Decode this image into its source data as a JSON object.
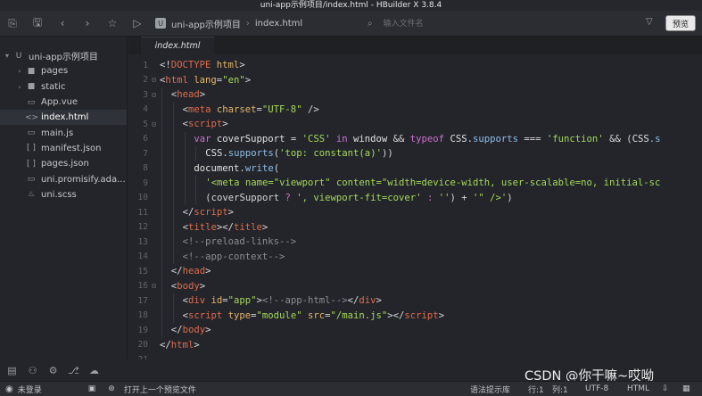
{
  "window": {
    "title": "uni-app示例项目/index.html - HBuilder X 3.8.4"
  },
  "toolbar": {
    "breadcrumb": [
      "uni-app示例项目",
      "index.html"
    ],
    "search_placeholder": "输入文件名",
    "preview_label": "预览"
  },
  "sidebar": {
    "items": [
      {
        "label": "uni-app示例项目",
        "icon": "project-icon",
        "arrow": "▾"
      },
      {
        "label": "pages",
        "icon": "folder-icon",
        "arrow": "›"
      },
      {
        "label": "static",
        "icon": "folder-icon",
        "arrow": "›"
      },
      {
        "label": "App.vue",
        "icon": "vue-file-icon",
        "arrow": ""
      },
      {
        "label": "index.html",
        "icon": "html-file-icon",
        "arrow": ""
      },
      {
        "label": "main.js",
        "icon": "js-file-icon",
        "arrow": ""
      },
      {
        "label": "manifest.json",
        "icon": "json-file-icon",
        "arrow": ""
      },
      {
        "label": "pages.json",
        "icon": "json-file-icon",
        "arrow": ""
      },
      {
        "label": "uni.promisify.ada...",
        "icon": "js-file-icon",
        "arrow": ""
      },
      {
        "label": "uni.scss",
        "icon": "scss-file-icon",
        "arrow": ""
      }
    ],
    "active_index": 4
  },
  "editor": {
    "tab_label": "index.html",
    "lines": [
      {
        "n": "1",
        "fold": "",
        "indent": 0,
        "tokens": [
          [
            "<!",
            "t"
          ],
          [
            "DOCTYPE",
            "r"
          ],
          [
            " html",
            "a"
          ],
          [
            ">",
            "t"
          ]
        ]
      },
      {
        "n": "2",
        "fold": "⊟",
        "indent": 0,
        "tokens": [
          [
            "<",
            "t"
          ],
          [
            "html",
            "r"
          ],
          [
            " lang",
            "a"
          ],
          [
            "=",
            "t"
          ],
          [
            "\"en\"",
            "s"
          ],
          [
            ">",
            "t"
          ]
        ]
      },
      {
        "n": "3",
        "fold": "⊟",
        "indent": 1,
        "tokens": [
          [
            "<",
            "t"
          ],
          [
            "head",
            "r"
          ],
          [
            ">",
            "t"
          ]
        ]
      },
      {
        "n": "4",
        "fold": "",
        "indent": 2,
        "tokens": [
          [
            "<",
            "t"
          ],
          [
            "meta",
            "r"
          ],
          [
            " charset",
            "a"
          ],
          [
            "=",
            "t"
          ],
          [
            "\"UTF-8\"",
            "s"
          ],
          [
            " />",
            "t"
          ]
        ]
      },
      {
        "n": "5",
        "fold": "⊟",
        "indent": 2,
        "tokens": [
          [
            "<",
            "t"
          ],
          [
            "script",
            "r"
          ],
          [
            ">",
            "t"
          ]
        ]
      },
      {
        "n": "6",
        "fold": "",
        "indent": 3,
        "tokens": [
          [
            "var ",
            "k"
          ],
          [
            "coverSupport ",
            "p"
          ],
          [
            "= ",
            "t"
          ],
          [
            "'CSS'",
            "s"
          ],
          [
            " in ",
            "k"
          ],
          [
            "window ",
            "p"
          ],
          [
            "&& ",
            "t"
          ],
          [
            "typeof ",
            "k"
          ],
          [
            "CSS",
            "p"
          ],
          [
            ".",
            "t"
          ],
          [
            "supports ",
            "f"
          ],
          [
            "=== ",
            "t"
          ],
          [
            "'function'",
            "s"
          ],
          [
            " && (",
            "t"
          ],
          [
            "CSS",
            "p"
          ],
          [
            ".s",
            "f"
          ]
        ]
      },
      {
        "n": "7",
        "fold": "",
        "indent": 4,
        "tokens": [
          [
            "CSS",
            "p"
          ],
          [
            ".",
            "t"
          ],
          [
            "supports",
            "f"
          ],
          [
            "(",
            "t"
          ],
          [
            "'top: constant(a)'",
            "s"
          ],
          [
            "))",
            "t"
          ]
        ]
      },
      {
        "n": "8",
        "fold": "",
        "indent": 3,
        "tokens": [
          [
            "document",
            "p"
          ],
          [
            ".",
            "t"
          ],
          [
            "write",
            "f"
          ],
          [
            "(",
            "t"
          ]
        ]
      },
      {
        "n": "9",
        "fold": "",
        "indent": 4,
        "tokens": [
          [
            "'<meta name=\"viewport\" content=\"width=device-width, user-scalable=no, initial-sc",
            "s"
          ]
        ]
      },
      {
        "n": "10",
        "fold": "",
        "indent": 4,
        "tokens": [
          [
            "(coverSupport ",
            "t"
          ],
          [
            "? ",
            "k"
          ],
          [
            "', viewport-fit=cover'",
            "s"
          ],
          [
            " : ",
            "k"
          ],
          [
            "''",
            "s"
          ],
          [
            ") + ",
            "t"
          ],
          [
            "'\" />'",
            "s"
          ],
          [
            ")",
            "t"
          ]
        ]
      },
      {
        "n": "11",
        "fold": "",
        "indent": 2,
        "tokens": [
          [
            "</",
            "t"
          ],
          [
            "script",
            "r"
          ],
          [
            ">",
            "t"
          ]
        ]
      },
      {
        "n": "12",
        "fold": "",
        "indent": 2,
        "tokens": [
          [
            "<",
            "t"
          ],
          [
            "title",
            "r"
          ],
          [
            "></",
            "t"
          ],
          [
            "title",
            "r"
          ],
          [
            ">",
            "t"
          ]
        ]
      },
      {
        "n": "13",
        "fold": "",
        "indent": 2,
        "tokens": [
          [
            "<!--preload-links-->",
            "c"
          ]
        ]
      },
      {
        "n": "14",
        "fold": "",
        "indent": 2,
        "tokens": [
          [
            "<!--app-context-->",
            "c"
          ]
        ]
      },
      {
        "n": "15",
        "fold": "",
        "indent": 1,
        "tokens": [
          [
            "</",
            "t"
          ],
          [
            "head",
            "r"
          ],
          [
            ">",
            "t"
          ]
        ]
      },
      {
        "n": "16",
        "fold": "⊟",
        "indent": 1,
        "tokens": [
          [
            "<",
            "t"
          ],
          [
            "body",
            "r"
          ],
          [
            ">",
            "t"
          ]
        ]
      },
      {
        "n": "17",
        "fold": "",
        "indent": 2,
        "tokens": [
          [
            "<",
            "t"
          ],
          [
            "div",
            "r"
          ],
          [
            " id",
            "a"
          ],
          [
            "=",
            "t"
          ],
          [
            "\"app\"",
            "s"
          ],
          [
            ">",
            "t"
          ],
          [
            "<!--app-html-->",
            "c"
          ],
          [
            "</",
            "t"
          ],
          [
            "div",
            "r"
          ],
          [
            ">",
            "t"
          ]
        ]
      },
      {
        "n": "18",
        "fold": "",
        "indent": 2,
        "tokens": [
          [
            "<",
            "t"
          ],
          [
            "script",
            "r"
          ],
          [
            " type",
            "a"
          ],
          [
            "=",
            "t"
          ],
          [
            "\"module\"",
            "s"
          ],
          [
            " src",
            "a"
          ],
          [
            "=",
            "t"
          ],
          [
            "\"/main.js\"",
            "s"
          ],
          [
            "></",
            "t"
          ],
          [
            "script",
            "r"
          ],
          [
            ">",
            "t"
          ]
        ]
      },
      {
        "n": "19",
        "fold": "",
        "indent": 1,
        "tokens": [
          [
            "</",
            "t"
          ],
          [
            "body",
            "r"
          ],
          [
            ">",
            "t"
          ]
        ]
      },
      {
        "n": "20",
        "fold": "",
        "indent": 0,
        "tokens": [
          [
            "</",
            "t"
          ],
          [
            "html",
            "r"
          ],
          [
            ">",
            "t"
          ]
        ]
      },
      {
        "n": "21",
        "fold": "",
        "indent": 0,
        "tokens": []
      }
    ]
  },
  "statusbar": {
    "login": "未登录",
    "message": "打开上一个预览文件",
    "syntax_hint": "语法提示库",
    "line": "行:1",
    "col": "列:1",
    "encoding": "UTF-8",
    "language": "HTML"
  },
  "watermark": "CSDN @你干嘛~哎呦",
  "colors": {
    "tag": "#e06c4a",
    "attr": "#e5b567",
    "string": "#a6d95a",
    "comment": "#8a8d93",
    "keyword": "#d070d0",
    "punct": "#d6d6d6",
    "plain": "#e1e1e1",
    "func": "#8fbfe8",
    "doctype": "#e06c4a"
  }
}
